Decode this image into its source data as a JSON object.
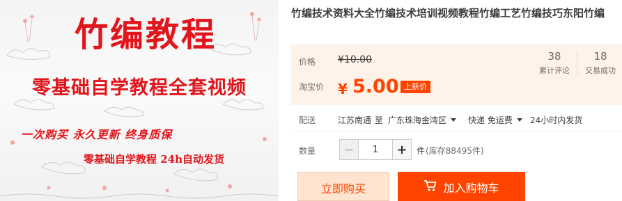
{
  "promo": {
    "title": "竹编教程",
    "subtitle": "零基础自学教程全套视频",
    "tagline": "一次购买  永久更新  终身质保",
    "footer": "零基础自学教程 24h自动发货"
  },
  "product": {
    "title": "竹编技术资料大全竹编技术培训视频教程竹编工艺竹编技巧东阳竹编"
  },
  "price": {
    "label": "价格",
    "original": "¥10.00",
    "taobao_label": "淘宝价",
    "currency": "¥",
    "current": "5.00",
    "badge": "上新价"
  },
  "stats": {
    "reviews_count": "38",
    "reviews_label": "累计评论",
    "sales_count": "18",
    "sales_label": "交易成功"
  },
  "shipping": {
    "label": "配送",
    "from": "江苏南通",
    "to_word": "至",
    "destination": "广东珠海金湾区",
    "method": "快递 免运费",
    "dispatch": "24小时内发货"
  },
  "quantity": {
    "label": "数量",
    "minus": "−",
    "value": "1",
    "plus": "+",
    "unit": "件",
    "stock": "(库存88495件)"
  },
  "actions": {
    "buy_now": "立即购买",
    "add_to_cart": "加入购物车"
  },
  "colors": {
    "accent": "#ff4400",
    "promo_red": "#e0161c",
    "price_bg": "#fff2e8"
  },
  "icons": {
    "cart": "cart-icon",
    "dropdown": "chevron-down-icon"
  }
}
